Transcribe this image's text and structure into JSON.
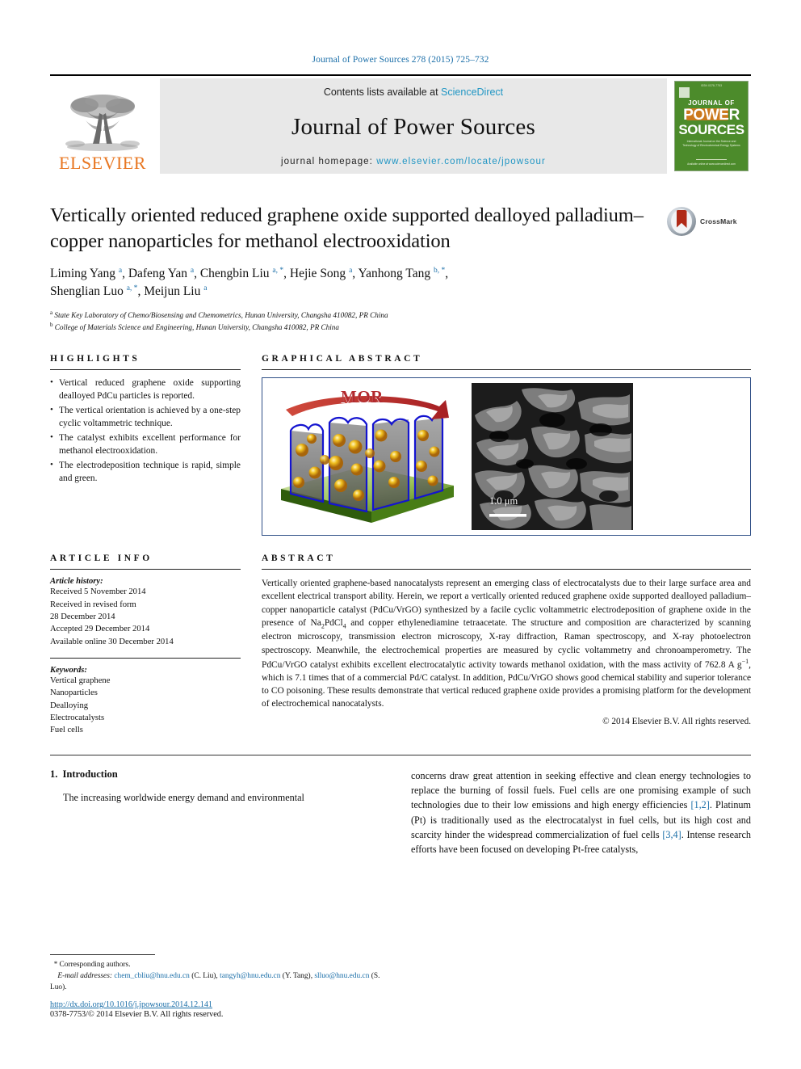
{
  "running_head": "Journal of Power Sources 278 (2015) 725–732",
  "masthead": {
    "contents_prefix": "Contents lists available at ",
    "sciencedirect": "ScienceDirect",
    "journal_name": "Journal of Power Sources",
    "homepage_prefix": "journal homepage: ",
    "homepage_url": "www.elsevier.com/locate/jpowsour",
    "publisher": "ELSEVIER",
    "cover": {
      "top_line": "ISSN 0378-7753",
      "word_journal": "JOURNAL OF",
      "word_power": "POWER",
      "word_sources": "SOURCES",
      "description": "International Journal on the Science and Technology of Electrochemical Energy Systems",
      "bottom": "Available online at www.sciencedirect.com"
    }
  },
  "crossmark": {
    "label": "CrossMark",
    "icon": "crossmark-icon"
  },
  "article": {
    "title": "Vertically oriented reduced graphene oxide supported dealloyed palladium–copper nanoparticles for methanol electrooxidation",
    "authors": [
      {
        "name": "Liming Yang",
        "marks": "a"
      },
      {
        "name": "Dafeng Yan",
        "marks": "a"
      },
      {
        "name": "Chengbin Liu",
        "marks": "a, *"
      },
      {
        "name": "Hejie Song",
        "marks": "a"
      },
      {
        "name": "Yanhong Tang",
        "marks": "b, *"
      },
      {
        "name": "Shenglian Luo",
        "marks": "a, *"
      },
      {
        "name": "Meijun Liu",
        "marks": "a"
      }
    ],
    "affiliations": [
      {
        "mark": "a",
        "text": "State Key Laboratory of Chemo/Biosensing and Chemometrics, Hunan University, Changsha 410082, PR China"
      },
      {
        "mark": "b",
        "text": "College of Materials Science and Engineering, Hunan University, Changsha 410082, PR China"
      }
    ]
  },
  "highlights": {
    "heading": "HIGHLIGHTS",
    "items": [
      "Vertical reduced graphene oxide supporting dealloyed PdCu particles is reported.",
      "The vertical orientation is achieved by a one-step cyclic voltammetric technique.",
      "The catalyst exhibits excellent performance for methanol electrooxidation.",
      "The electrodeposition technique is rapid, simple and green."
    ]
  },
  "article_info": {
    "heading": "ARTICLE INFO",
    "history_label": "Article history:",
    "history": [
      "Received 5 November 2014",
      "Received in revised form",
      "28 December 2014",
      "Accepted 29 December 2014",
      "Available online 30 December 2014"
    ],
    "keywords_label": "Keywords:",
    "keywords": [
      "Vertical graphene",
      "Nanoparticles",
      "Dealloying",
      "Electrocatalysts",
      "Fuel cells"
    ]
  },
  "graphical_abstract": {
    "heading": "GRAPHICAL ABSTRACT",
    "schematic_label": "MOR",
    "sem_scale_bar": "1.0 μm"
  },
  "abstract": {
    "heading": "ABSTRACT",
    "part1": "Vertically oriented graphene-based nanocatalysts represent an emerging class of electrocatalysts due to their large surface area and excellent electrical transport ability. Herein, we report a vertically oriented reduced graphene oxide supported dealloyed palladium–copper nanoparticle catalyst (PdCu/VrGO) synthesized by a facile cyclic voltammetric electrodeposition of graphene oxide in the presence of Na",
    "sub1": "2",
    "part2": "PdCl",
    "sub2": "4",
    "part3": " and copper ethylenediamine tetraacetate. The structure and composition are characterized by scanning electron microscopy, transmission electron microscopy, X-ray diffraction, Raman spectroscopy, and X-ray photoelectron spectroscopy. Meanwhile, the electrochemical properties are measured by cyclic voltammetry and chronoamperometry. The PdCu/VrGO catalyst exhibits excellent electrocatalytic activity towards methanol oxidation, with the mass activity of 762.8 A g",
    "sup1": "−1",
    "part4": ", which is 7.1 times that of a commercial Pd/C catalyst. In addition, PdCu/VrGO shows good chemical stability and superior tolerance to CO poisoning. These results demonstrate that vertical reduced graphene oxide provides a promising platform for the development of electrochemical nanocatalysts.",
    "copyright": "© 2014 Elsevier B.V. All rights reserved."
  },
  "body": {
    "section_number": "1.",
    "section_title": "Introduction",
    "left_para": "The increasing worldwide energy demand and environmental",
    "right_para_1": "concerns draw great attention in seeking effective and clean energy technologies to replace the burning of fossil fuels. Fuel cells are one promising example of such technologies due to their low emissions and high energy efficiencies ",
    "cite_1": "[1,2]",
    "right_para_2": ". Platinum (Pt) is traditionally used as the electrocatalyst in fuel cells, but its high cost and scarcity hinder the widespread commercialization of fuel cells ",
    "cite_2": "[3,4]",
    "right_para_3": ". Intense research efforts have been focused on developing Pt-free catalysts,"
  },
  "footnotes": {
    "corresponding": "Corresponding authors.",
    "email_label": "E-mail addresses:",
    "emails": [
      {
        "address": "chem_cbliu@hnu.edu.cn",
        "owner": "(C. Liu)"
      },
      {
        "address": "tangyh@hnu.edu.cn",
        "owner": "(Y. Tang)"
      },
      {
        "address": "slluo@hnu.edu.cn",
        "owner": "(S. Luo)"
      }
    ],
    "doi": "http://dx.doi.org/10.1016/j.jpowsour.2014.12.141",
    "issn": "0378-7753/© 2014 Elsevier B.V. All rights reserved."
  },
  "colors": {
    "link_blue": "#1a6ea8",
    "sciencedirect_blue": "#2196c4",
    "elsevier_orange": "#e87722",
    "frame_blue": "#2f4f86",
    "cover_green": "#4c8b2b",
    "mor_red": "#b2292e"
  }
}
